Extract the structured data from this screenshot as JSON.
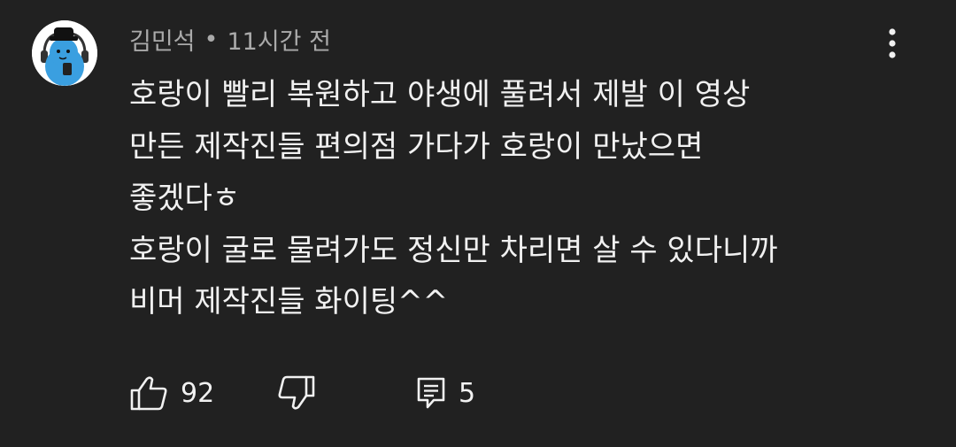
{
  "comment": {
    "author": "김민석",
    "separator": "•",
    "time": "11시간 전",
    "body_lines": [
      "호랑이 빨리 복원하고 야생에 풀려서 제발 이 영상",
      "만든 제작진들 편의점 가다가 호랑이 만났으면",
      "좋겠다ㅎ",
      "호랑이 굴로 물려가도 정신만 차리면 살 수 있다니까",
      "비머 제작진들 화이팅^^"
    ],
    "like_count": "92",
    "reply_count": "5"
  },
  "icons": {
    "more": "more-vert-icon",
    "like": "thumbs-up-icon",
    "dislike": "thumbs-down-icon",
    "reply": "comment-reply-icon"
  },
  "colors": {
    "background": "#212121",
    "text_primary": "#f1f1f1",
    "text_secondary": "#aaaaaa",
    "avatar_blue": "#3a9fe0"
  }
}
